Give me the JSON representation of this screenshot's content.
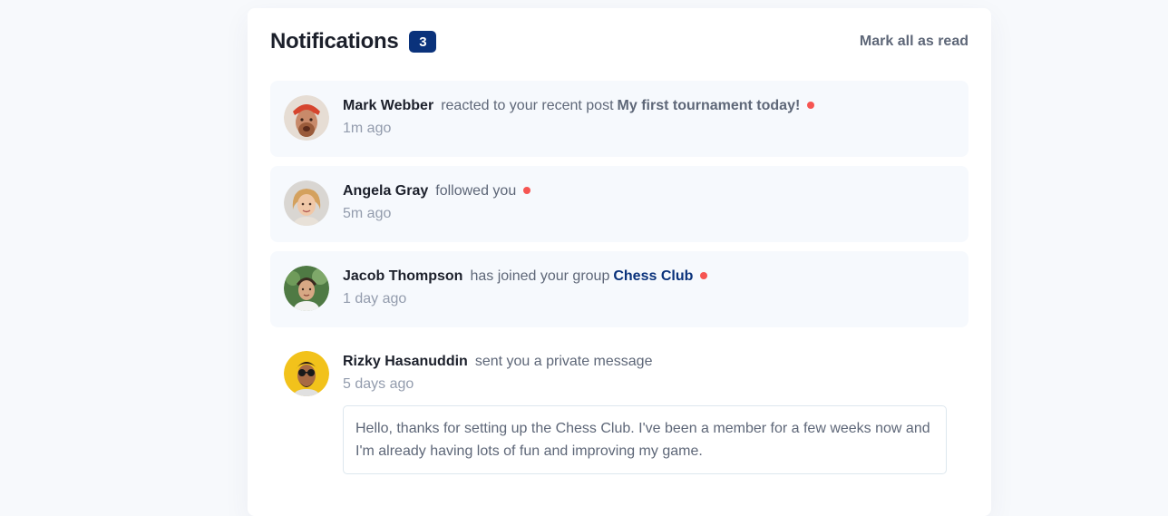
{
  "header": {
    "title": "Notifications",
    "unread_count": "3",
    "mark_all_label": "Mark all as read"
  },
  "colors": {
    "badge": "#0a327b",
    "unread_bg": "#f6f9fd",
    "dot": "#f65552",
    "group_link": "#0a327b"
  },
  "notifications": [
    {
      "name": "Mark Webber",
      "action": "reacted to your recent post",
      "target": "My first tournament today!",
      "time": "1m ago",
      "unread": true,
      "avatar": "mark-webber-avatar"
    },
    {
      "name": "Angela Gray",
      "action": "followed you",
      "time": "5m ago",
      "unread": true,
      "avatar": "angela-gray-avatar"
    },
    {
      "name": "Jacob Thompson",
      "action": "has joined your group",
      "target": "Chess Club",
      "time": "1 day ago",
      "unread": true,
      "avatar": "jacob-thompson-avatar"
    },
    {
      "name": "Rizky Hasanuddin",
      "action": "sent you a private message",
      "time": "5 days ago",
      "unread": false,
      "avatar": "rizky-hasanuddin-avatar",
      "message": "Hello, thanks for setting up the Chess Club. I've been a member for a few weeks now and I'm already having lots of fun and improving my game."
    }
  ]
}
